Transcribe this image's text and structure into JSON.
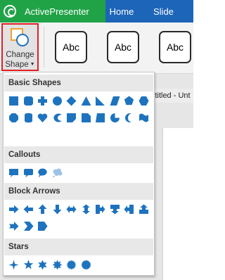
{
  "titlebar": {
    "app_name": "ActivePresenter",
    "menu": [
      "Home",
      "Slide"
    ]
  },
  "ribbon": {
    "change_shape_label_1": "Change",
    "change_shape_label_2": "Shape",
    "style_samples": [
      "Abc",
      "Abc",
      "Abc"
    ]
  },
  "document": {
    "tab_title": "ititled - Unt"
  },
  "dropdown": {
    "sections": [
      {
        "title": "Basic Shapes",
        "icons": [
          "rectangle-icon",
          "rounded-rectangle-icon",
          "plus-icon",
          "circle-icon",
          "diamond-icon",
          "triangle-icon",
          "right-triangle-icon",
          "parallelogram-icon",
          "pentagon-icon",
          "hexagon-icon",
          "octagon-icon",
          "can-icon",
          "heart-icon",
          "moon-icon",
          "folded-corner-icon",
          "snip-corner-icon",
          "trapezoid-icon",
          "pie-icon",
          "crescent-icon",
          "wave-icon"
        ]
      },
      {
        "title": "Callouts",
        "icons": [
          "rect-callout-icon",
          "rounded-callout-icon",
          "oval-callout-icon",
          "cloud-callout-icon"
        ]
      },
      {
        "title": "Block Arrows",
        "icons": [
          "right-arrow-icon",
          "left-arrow-icon",
          "up-arrow-icon",
          "down-arrow-icon",
          "left-right-arrow-icon",
          "up-down-arrow-icon",
          "right-arrow-callout-icon",
          "down-arrow-callout-icon",
          "left-arrow-callout-icon",
          "up-arrow-callout-icon",
          "notched-right-arrow-icon",
          "chevron-icon",
          "pentagon-arrow-icon"
        ]
      },
      {
        "title": "Stars",
        "icons": [
          "star-4-icon",
          "star-5-icon",
          "star-6-icon",
          "star-8-icon",
          "star-16-icon",
          "star-24-icon"
        ]
      }
    ]
  },
  "colors": {
    "app_green": "#20a347",
    "menu_blue": "#1d65b9",
    "shape_blue": "#1e73be",
    "highlight_red": "#e11f25"
  }
}
